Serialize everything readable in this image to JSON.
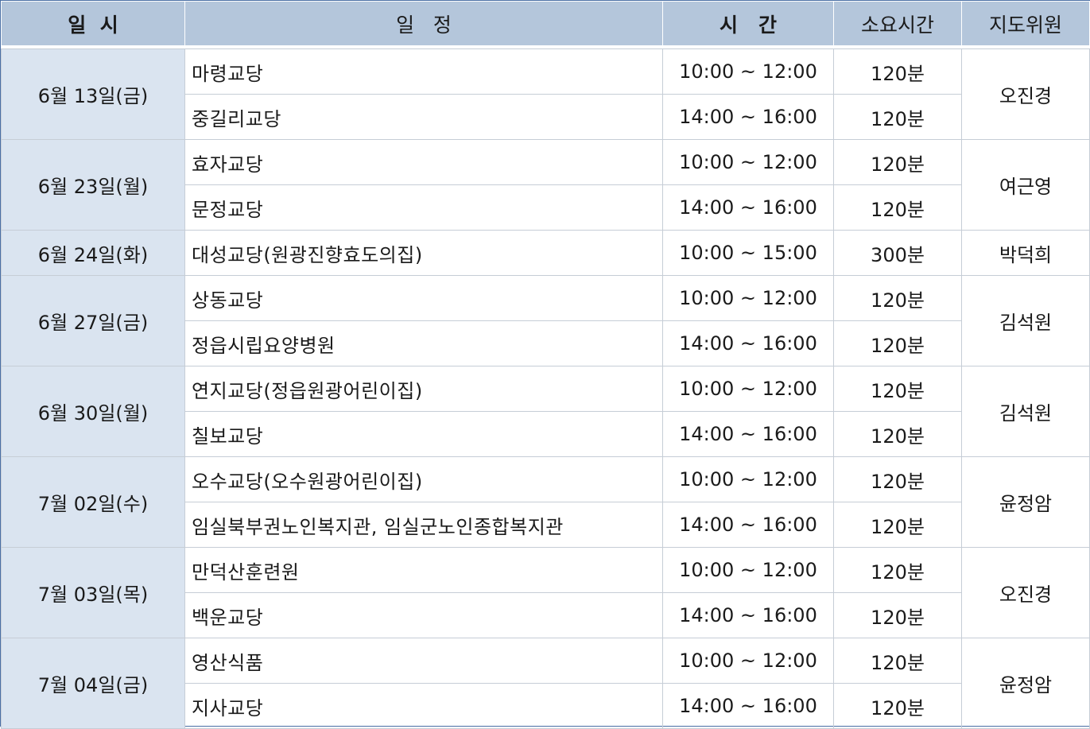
{
  "headers": {
    "date": "일  시",
    "schedule": "일   정",
    "time": "시   간",
    "duration": "소요시간",
    "instructor": "지도위원"
  },
  "groups": [
    {
      "date": "6월 13일(금)",
      "instructor": "오진경",
      "rows": [
        {
          "schedule": "마령교당",
          "time": "10:00 ~ 12:00",
          "duration": "120분"
        },
        {
          "schedule": "중길리교당",
          "time": "14:00 ~ 16:00",
          "duration": "120분"
        }
      ]
    },
    {
      "date": "6월 23일(월)",
      "instructor": "여근영",
      "rows": [
        {
          "schedule": "효자교당",
          "time": "10:00 ~ 12:00",
          "duration": "120분"
        },
        {
          "schedule": "문정교당",
          "time": "14:00 ~ 16:00",
          "duration": "120분"
        }
      ]
    },
    {
      "date": "6월 24일(화)",
      "instructor": "박덕희",
      "rows": [
        {
          "schedule": "대성교당(원광진향효도의집)",
          "time": "10:00 ~ 15:00",
          "duration": "300분"
        }
      ]
    },
    {
      "date": "6월 27일(금)",
      "instructor": "김석원",
      "rows": [
        {
          "schedule": "상동교당",
          "time": "10:00 ~ 12:00",
          "duration": "120분"
        },
        {
          "schedule": "정읍시립요양병원",
          "time": "14:00 ~ 16:00",
          "duration": "120분"
        }
      ]
    },
    {
      "date": "6월 30일(월)",
      "instructor": "김석원",
      "rows": [
        {
          "schedule": "연지교당(정읍원광어린이집)",
          "time": "10:00 ~ 12:00",
          "duration": "120분"
        },
        {
          "schedule": "칠보교당",
          "time": "14:00 ~ 16:00",
          "duration": "120분"
        }
      ]
    },
    {
      "date": "7월 02일(수)",
      "instructor": "윤정암",
      "rows": [
        {
          "schedule": "오수교당(오수원광어린이집)",
          "time": "10:00 ~ 12:00",
          "duration": "120분"
        },
        {
          "schedule": "임실북부권노인복지관, 임실군노인종합복지관",
          "time": "14:00 ~ 16:00",
          "duration": "120분"
        }
      ]
    },
    {
      "date": "7월 03일(목)",
      "instructor": "오진경",
      "rows": [
        {
          "schedule": "만덕산훈련원",
          "time": "10:00 ~ 12:00",
          "duration": "120분"
        },
        {
          "schedule": "백운교당",
          "time": "14:00 ~ 16:00",
          "duration": "120분"
        }
      ]
    },
    {
      "date": "7월 04일(금)",
      "instructor": "윤정암",
      "rows": [
        {
          "schedule": "영산식품",
          "time": "10:00 ~ 12:00",
          "duration": "120분"
        },
        {
          "schedule": "지사교당",
          "time": "14:00 ~ 16:00",
          "duration": "120분"
        }
      ]
    }
  ]
}
